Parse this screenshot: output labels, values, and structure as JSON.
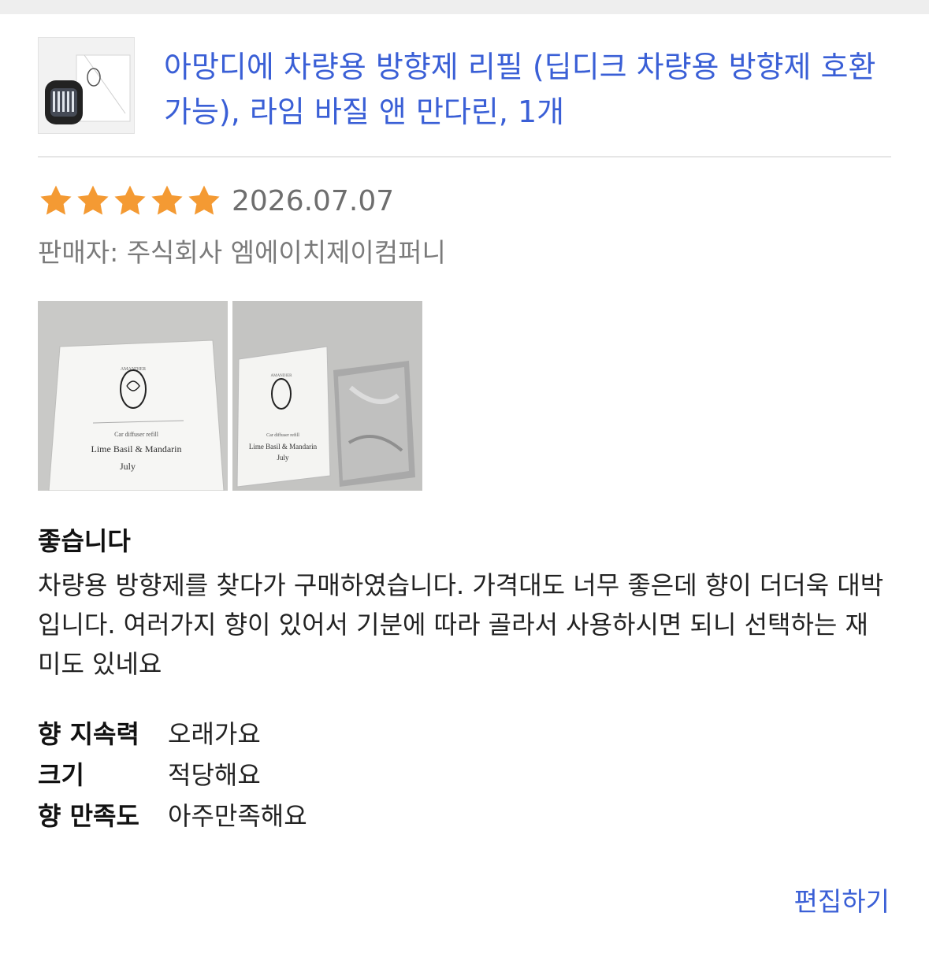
{
  "product": {
    "title": "아망디에 차량용 방향제 리필 (딥디크 차량용 방향제 호환 가능), 라임 바질 앤 만다린, 1개"
  },
  "review": {
    "rating": 5,
    "rating_max": 5,
    "date": "2026.07.07",
    "seller": "판매자: 주식회사 엠에이치제이컴퍼니",
    "headline": "좋습니다",
    "body": "차량용 방향제를 찾다가 구매하였습니다. 가격대도 너무 좋은데 향이 더더욱 대박입니다. 여러가지 향이 있어서 기분에 따라 골라서 사용하시면 되니 선택하는 재미도 있네요"
  },
  "photos": [
    {
      "label": "photo-1",
      "brand": "AMANDIER",
      "line1": "Car diffuser refill",
      "line2": "Lime Basil & Mandarin",
      "line3": "July"
    },
    {
      "label": "photo-2",
      "brand": "AMANDIER",
      "line1": "Car diffuser refill",
      "line2": "Lime Basil & Mandarin",
      "line3": "July"
    }
  ],
  "attributes": [
    {
      "label": "향 지속력",
      "value": "오래가요"
    },
    {
      "label": "크기",
      "value": "적당해요"
    },
    {
      "label": "향 만족도",
      "value": "아주만족해요"
    }
  ],
  "actions": {
    "edit_label": "편집하기"
  },
  "colors": {
    "link": "#3a5fd6",
    "star": "#f49a33",
    "muted": "#7a7a7a"
  },
  "icons": {
    "star": "star-icon"
  }
}
